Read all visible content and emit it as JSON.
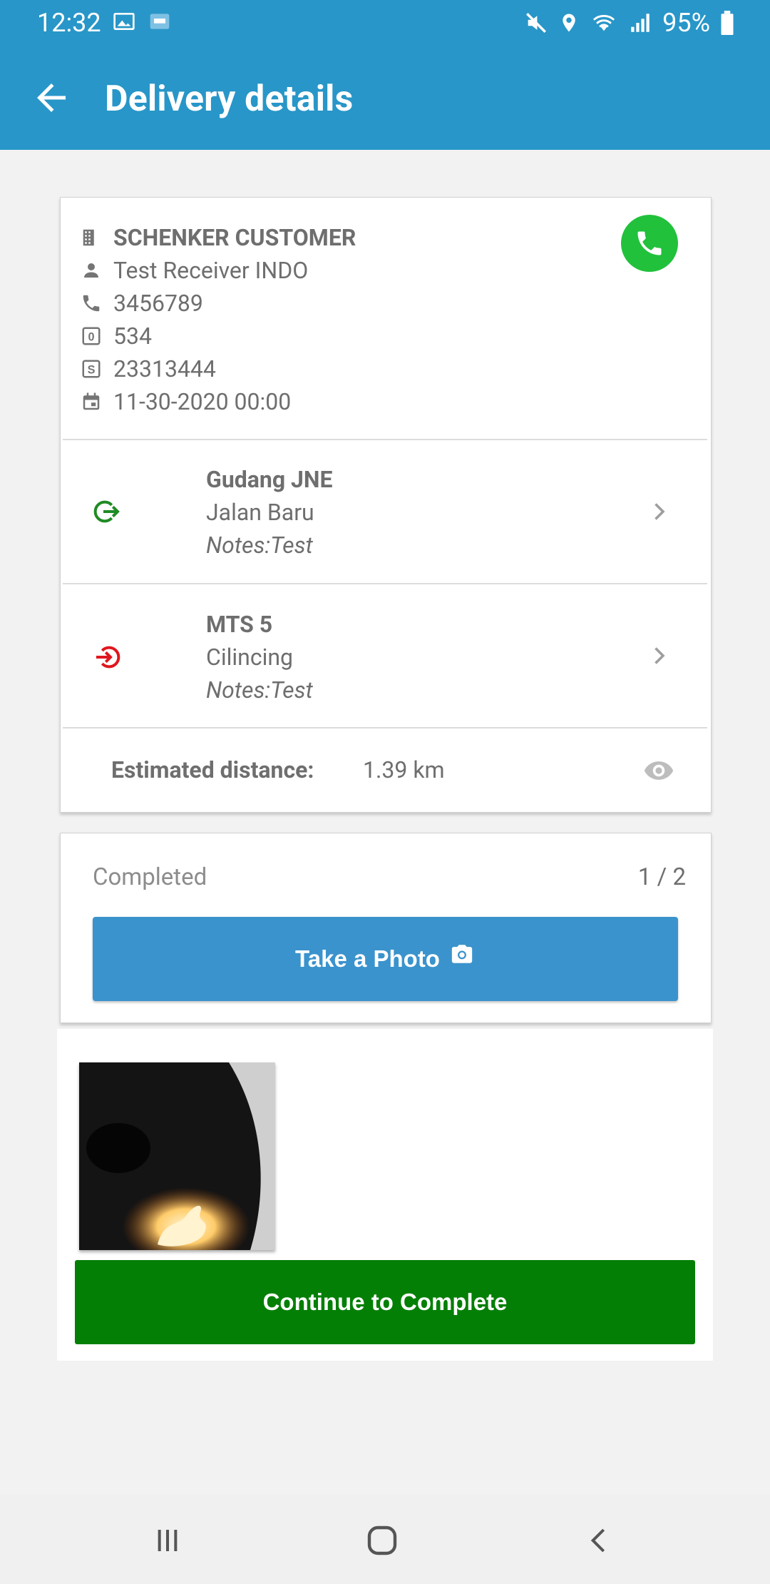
{
  "status_bar": {
    "time": "12:32",
    "battery": "95%"
  },
  "app_bar": {
    "title": "Delivery details"
  },
  "delivery_info": {
    "customer": "SCHENKER CUSTOMER",
    "receiver": "Test Receiver INDO",
    "phone": "3456789",
    "field_0": "534",
    "field_s": "23313444",
    "date": "11-30-2020 00:00"
  },
  "pickup": {
    "name": "Gudang JNE",
    "address": "Jalan Baru",
    "notes": "Notes:Test"
  },
  "dropoff": {
    "name": "MTS 5",
    "address": "Cilincing",
    "notes": "Notes:Test"
  },
  "distance": {
    "label": "Estimated distance:",
    "value": "1.39 km"
  },
  "photo_section": {
    "status": "Completed",
    "count": "1 / 2",
    "take_photo_label": "Take a Photo"
  },
  "continue_label": "Continue to Complete",
  "colors": {
    "app_bar": "#2896c8",
    "call_button": "#21c13c",
    "take_photo_button": "#3a93cc",
    "continue_button": "#047f06",
    "pickup_icon": "#1f8b25",
    "dropoff_icon": "#e0161f"
  }
}
